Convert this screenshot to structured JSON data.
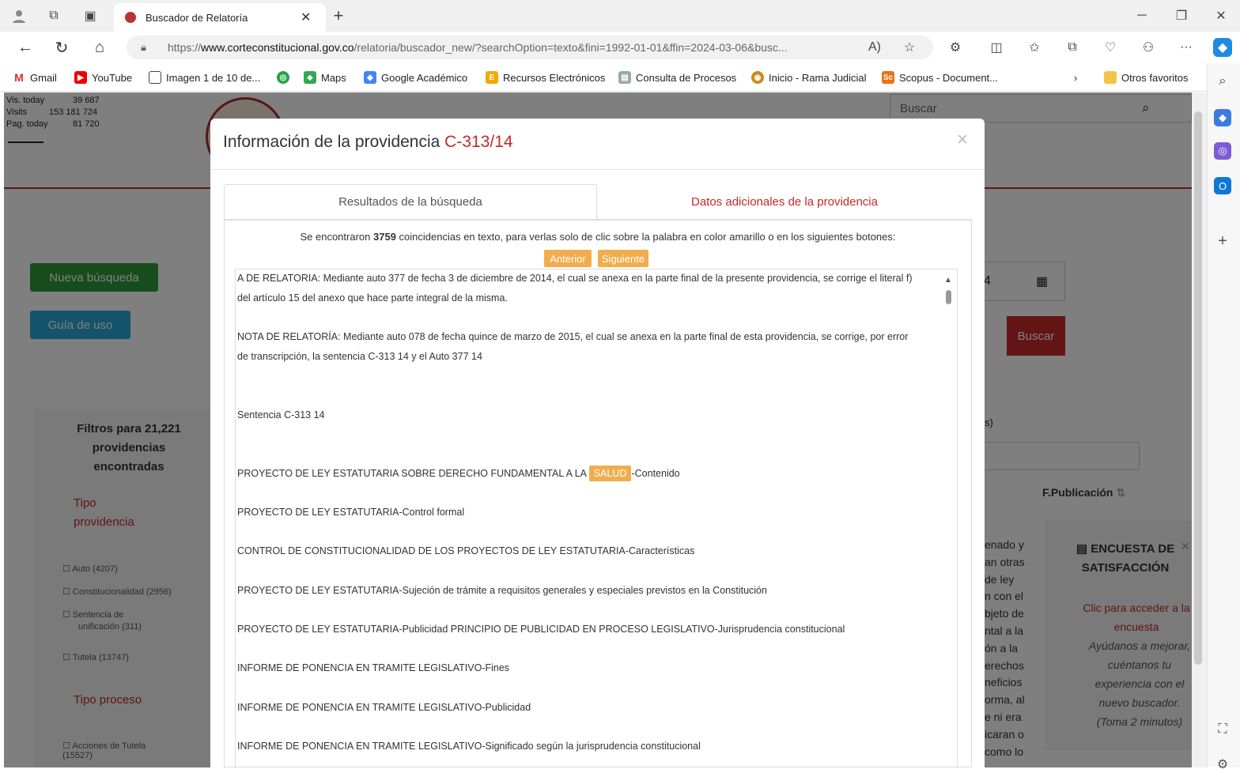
{
  "browser": {
    "tab_title": "Buscador de Relatoría",
    "url_prefix": "https://",
    "url_host": "www.corteconstitucional.gov.co",
    "url_path": "/relatoria/buscador_new/?searchOption=texto&fini=1992-01-01&ffin=2024-03-06&busc...",
    "bookmarks": [
      "Gmail",
      "YouTube",
      "Imagen 1 de 10 de...",
      "Maps",
      "Google Académico",
      "Recursos Electrónicos",
      "Consulta de Procesos",
      "Inicio - Rama Judicial",
      "Scopus - Document...",
      "Otros favoritos"
    ]
  },
  "page": {
    "stats": {
      "vis_today_label": "Vis. today",
      "vis_today": "39 687",
      "visits_label": "Visits",
      "visits": "153 181 724",
      "pag_today_label": "Pag. today",
      "pag_today": "81 720"
    },
    "search_placeholder": "Buscar",
    "nueva_busqueda": "Nueva búsqueda",
    "guia_uso": "Guía de uso",
    "filters_title": "Filtros para 21,221 providencias encontradas",
    "tipo_providencia": "Tipo providencia",
    "filter_items": [
      "Auto (4207)",
      "Constitucionalidad (2956)",
      "Sentencia de unificación (311)",
      "Tutela (13747)"
    ],
    "tipo_proceso": "Tipo proceso",
    "proceso_item": "Acciones de Tutela (15527)",
    "date_fragment": "4",
    "buscar_button": "Buscar",
    "s_fragment": "s)",
    "fpub_header": "F.Publicación",
    "partial_lines": [
      "enado y",
      "an otras",
      "de ley",
      "n con el",
      "bjeto de",
      "ntal a la",
      "ón a la",
      "erechos",
      "neficios",
      "orma, al",
      "e ni era",
      "icaran o",
      "como lo"
    ],
    "survey_title": "ENCUESTA DE SATISFACCIÓN",
    "survey_link": "Clic para acceder a la encuesta",
    "survey_text": "Ayúdanos a mejorar, cuéntanos tu experiencia con el nuevo buscador. (Toma 2 minutos)"
  },
  "modal": {
    "title_prefix": "Información de la providencia ",
    "title_id": "C-313/14",
    "tab_results": "Resultados de la búsqueda",
    "tab_additional": "Datos adicionales de la providencia",
    "found_prefix": "Se encontraron ",
    "found_count": "3759",
    "found_suffix": " coincidencias en texto, para verlas solo de clic sobre la palabra en color amarillo o en los siguientes botones:",
    "btn_prev": "Anterior",
    "btn_next": "Siguiente",
    "lines": [
      "A DE RELATORIA:  Mediante auto 377 de fecha 3 de diciembre de 2014, el cual se anexa en la parte final de la presente providencia, se corrige el literal f)",
      "del artículo 15 del anexo que hace parte integral de la misma.",
      "NOTA DE RELATORÍA:  Mediante auto 078 de fecha quince de marzo de 2015, el cual se anexa en la parte final de esta providencia,  se  corrige, por error",
      "de transcripción, la sentencia C-313 14 y el Auto 377 14",
      "Sentencia C-313 14",
      "PROYECTO DE LEY ESTATUTARIA-Control formal",
      "CONTROL DE CONSTITUCIONALIDAD DE LOS PROYECTOS DE LEY ESTATUTARIA-Características",
      "PROYECTO DE LEY ESTATUTARIA-Sujeción de trámite a requisitos generales y especiales previstos en la Constitución",
      "PROYECTO DE LEY ESTATUTARIA-Publicidad PRINCIPIO DE PUBLICIDAD EN PROCESO LEGISLATIVO-Jurisprudencia constitucional",
      "INFORME DE PONENCIA EN TRAMITE LEGISLATIVO-Fines",
      "INFORME DE PONENCIA EN TRAMITE LEGISLATIVO-Publicidad",
      "INFORME DE PONENCIA EN TRAMITE LEGISLATIVO-Significado según la jurisprudencia constitucional"
    ],
    "hl_line_pre": "PROYECTO DE LEY ESTATUTARIA SOBRE DERECHO FUNDAMENTAL A LA ",
    "hl_word": "SALUD",
    "hl_line_post": "-Contenido"
  },
  "colors": {
    "accent_red": "#c62828",
    "highlight": "#f0ad4e",
    "green_button": "#2e9b3a",
    "blue_button": "#2aa6d6"
  }
}
